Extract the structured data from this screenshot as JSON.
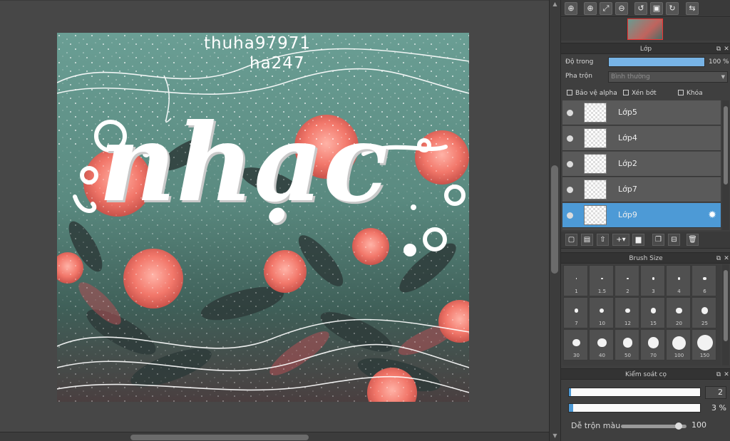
{
  "artwork": {
    "credit_line1": "thuha97971",
    "credit_line2": "ha247",
    "title_text": "nhạc"
  },
  "nav_toolbar": {
    "icons": [
      "zoom-in-icon",
      "zoom-in-alt-icon",
      "fit-icon",
      "zoom-out-icon",
      "rotate-left-icon",
      "fit-window-icon",
      "rotate-right-icon",
      "flip-icon"
    ]
  },
  "layer_panel": {
    "title": "Lớp",
    "opacity_label": "Độ trong",
    "opacity_value": "100 %",
    "opacity_percent": 100,
    "blend_label": "Pha trộn",
    "blend_value": "Bình thường",
    "protect_alpha": "Bảo vệ alpha",
    "clipping": "Xén bớt",
    "lock": "Khóa",
    "layers": [
      {
        "name": "Lớp5",
        "selected": false
      },
      {
        "name": "Lớp4",
        "selected": false
      },
      {
        "name": "Lớp2",
        "selected": false
      },
      {
        "name": "Lớp7",
        "selected": false
      },
      {
        "name": "Lớp9",
        "selected": true
      }
    ],
    "selection_color": "#4d9ad6"
  },
  "brush_size_panel": {
    "title": "Brush Size",
    "sizes": [
      "1",
      "1.5",
      "2",
      "3",
      "4",
      "6",
      "7",
      "10",
      "12",
      "15",
      "20",
      "25",
      "30",
      "40",
      "50",
      "70",
      "100",
      "150"
    ]
  },
  "brush_control_panel": {
    "title": "Kiểm soát cọ",
    "size_value": "2",
    "size_fraction": 0.01,
    "opacity_value": "3 %",
    "opacity_fraction": 0.03,
    "blend_label": "Dễ trộn màu",
    "blend_value": "100",
    "blend_fraction": 1.0
  }
}
